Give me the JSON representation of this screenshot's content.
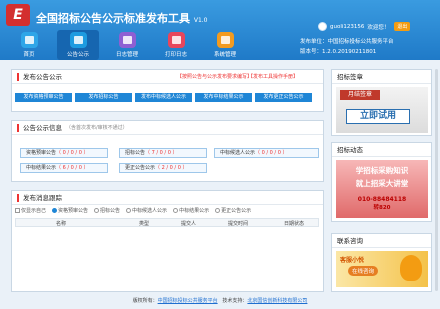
{
  "app": {
    "title": "全国招标公告公示标准发布工具",
    "version": "V1.0",
    "logo_letter": "E"
  },
  "user": {
    "name": "guoli123156",
    "greeting": "欢迎您！",
    "exit": "退出"
  },
  "info": {
    "publisher": "发布单位：中国招标投标公共服务平台",
    "version_label": "版本号：1.2.0.20190211801"
  },
  "nav": [
    {
      "label": "首页",
      "icon": "home-icon"
    },
    {
      "label": "公告公示",
      "icon": "notice-icon"
    },
    {
      "label": "日志管理",
      "icon": "log-icon"
    },
    {
      "label": "打印日志",
      "icon": "print-icon"
    },
    {
      "label": "系统管理",
      "icon": "settings-icon"
    }
  ],
  "publish": {
    "title": "发布公告公示",
    "link1": "【按照公告与公示发布要求编写】",
    "link2": "【发布工具操作手册】",
    "buttons": [
      "发布资格预审公告",
      "发布招标公告",
      "发布中标候选人公示",
      "发布中标结果公示",
      "发布更正公告公示"
    ]
  },
  "stats": {
    "title": "公告公示信息",
    "subtitle": "（含首次发布/审核不通过）",
    "cards": [
      {
        "label": "资格预审公告",
        "nums": "（ 0 / 0 / 0 ）"
      },
      {
        "label": "招标公告",
        "nums": "（ 7 / 0 / 0 ）"
      },
      {
        "label": "中标候选人公示",
        "nums": "（ 0 / 0 / 0 ）"
      },
      {
        "label": "中标结果公示",
        "nums": "（ 6 / 0 / 0 ）"
      },
      {
        "label": "更正公告公示",
        "nums": "（ 2 / 0 / 0 ）"
      }
    ]
  },
  "records": {
    "title": "发布消息跟踪",
    "filter_only": "仅显示自己",
    "filters": [
      "资格预审公告",
      "招标公告",
      "中标候选人公示",
      "中标结果公示",
      "更正公告公示"
    ],
    "columns": [
      "名称",
      "类型",
      "提交人",
      "提交时间",
      "日期状态"
    ]
  },
  "sidebar": {
    "ad_title": "招标签章",
    "ad_main": "月结签章",
    "ad_button": "立即试用",
    "news_title": "招标动态",
    "news_line1": "学招标采购知识",
    "news_line2": "就上招采大讲堂",
    "news_phone": "010-88484118",
    "news_ext": "转820",
    "contact_title": "联系咨询",
    "contact_label": "客服小悦",
    "contact_btn": "在线咨询"
  },
  "footer": {
    "prefix": "版权所有：",
    "owner": "中国招标投标公共服务平台",
    "tech": "技术支持：",
    "tech_owner": "北京国信创新科技有限公司"
  },
  "colors": {
    "accent": "#1f86d6",
    "header": "#1f7ac8",
    "alert": "#e33"
  }
}
